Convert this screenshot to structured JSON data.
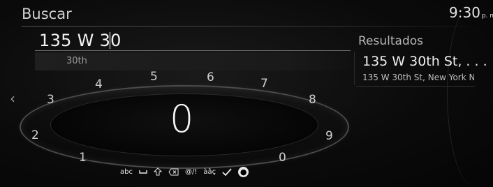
{
  "header": {
    "title": "Buscar",
    "clock_time": "9:30",
    "clock_ampm": "p. m."
  },
  "search": {
    "input_value": "135 W 30",
    "suggestion": "30th"
  },
  "results": {
    "label": "Resultados",
    "items": [
      {
        "title": "135 W 30th St, . . .",
        "subtitle": "135 W 30th St, New York N"
      }
    ]
  },
  "dial": {
    "digits": [
      "1",
      "2",
      "3",
      "4",
      "5",
      "6",
      "7",
      "8",
      "9",
      "0"
    ],
    "selected_digit": "0"
  },
  "toolbar": {
    "abc_label": "abc",
    "space_icon": "space-icon",
    "shift_icon": "shift-icon",
    "backspace_icon": "backspace-icon",
    "symbols_label": "@/!",
    "accents_label": "àâç",
    "confirm_icon": "checkmark-icon",
    "language_icon": "globe-icon"
  },
  "nav": {
    "back_icon": "chevron-left-icon"
  },
  "colors": {
    "background": "#0b0b0b",
    "text": "#d8d8d8",
    "ring": "#4c4c4c"
  }
}
